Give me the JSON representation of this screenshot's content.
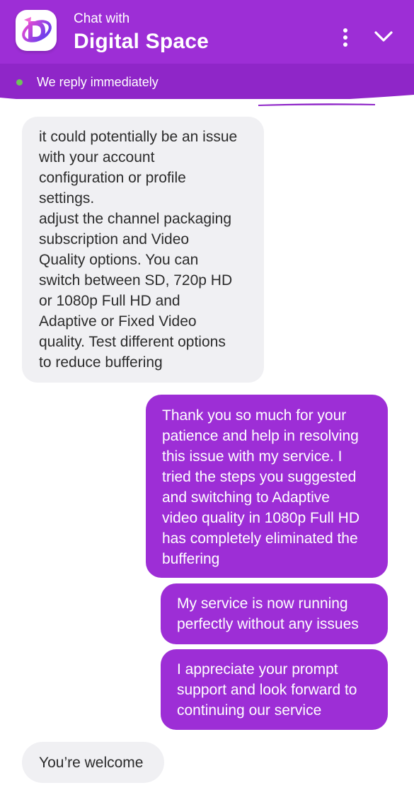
{
  "header": {
    "subtitle": "Chat with",
    "title": "Digital Space",
    "logo_icon": "digital-space-logo",
    "menu_icon": "vertical-dots-icon",
    "collapse_icon": "chevron-down-icon"
  },
  "status": {
    "text": "We reply immediately",
    "indicator_color": "#6fc35a"
  },
  "colors": {
    "brand": "#9d2ed6",
    "incoming_bubble": "#f0f0f3"
  },
  "messages": [
    {
      "from": "agent",
      "text": "it could potentially be an issue\nwith your account\nconfiguration or profile\nsettings.\nadjust the channel packaging\nsubscription and Video\nQuality options. You can\nswitch between SD, 720p HD\nor 1080p Full HD and\nAdaptive or Fixed Video\nquality. Test different options\nto reduce buffering"
    },
    {
      "from": "user",
      "text": "Thank you so much for your\npatience and help in resolving\nthis issue with my service. I\ntried the steps you suggested\nand switching to Adaptive\nvideo quality in 1080p Full HD\nhas completely eliminated the\nbuffering"
    },
    {
      "from": "user",
      "text": "My service is now running\nperfectly without any issues"
    },
    {
      "from": "user",
      "text": "I appreciate your prompt\nsupport and look forward to\ncontinuing our service"
    },
    {
      "from": "agent",
      "text": "You’re welcome"
    }
  ]
}
